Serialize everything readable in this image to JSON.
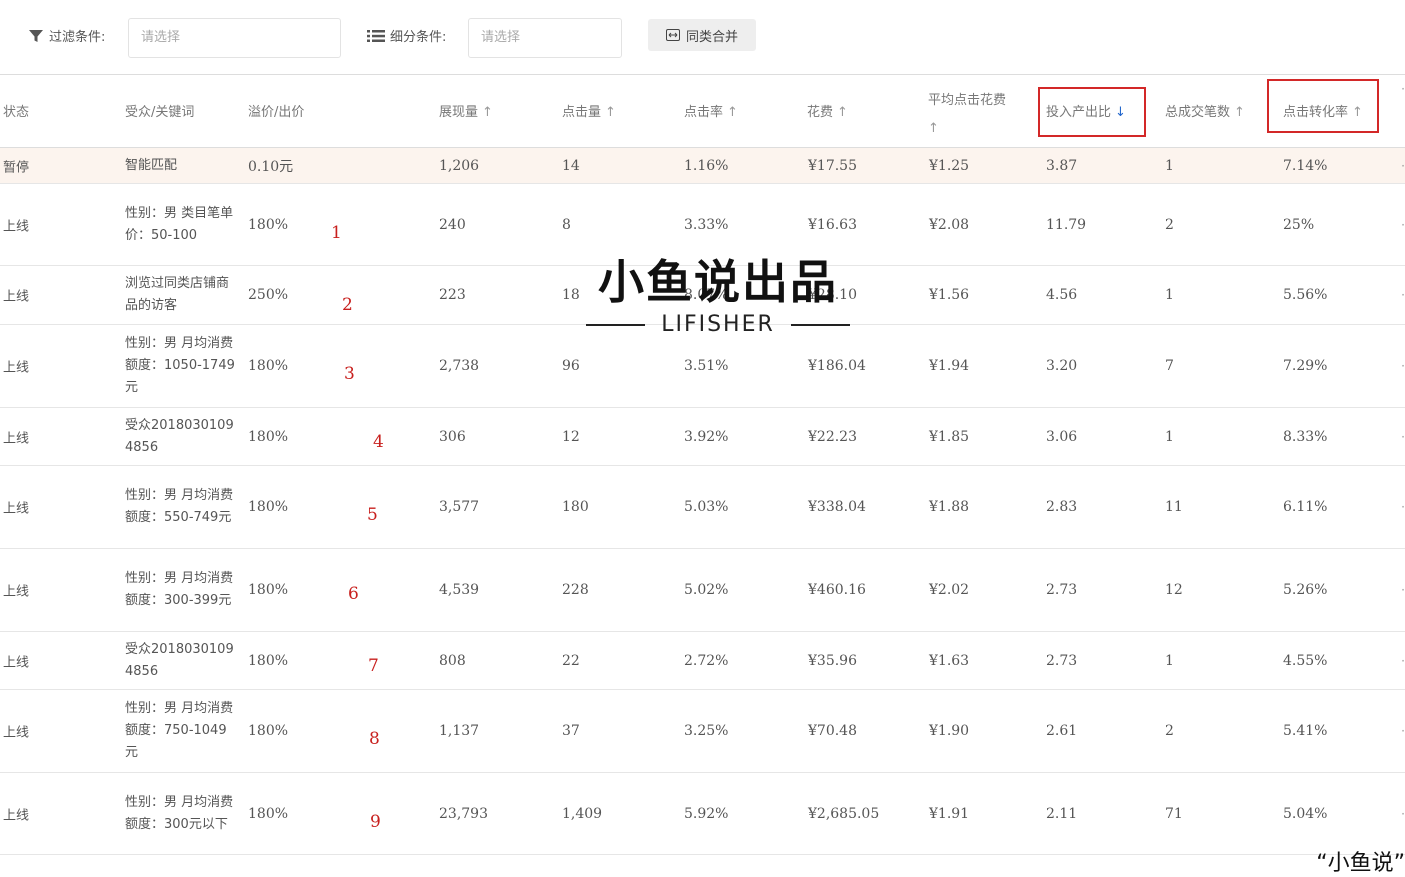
{
  "toolbar": {
    "filter_label": "过滤条件:",
    "filter_placeholder": "请选择",
    "segment_label": "细分条件:",
    "segment_placeholder": "请选择",
    "merge_button": "同类合并"
  },
  "columns": {
    "status": "状态",
    "audience": "受众/关键词",
    "bid": "溢价/出价",
    "impressions": "展现量",
    "clicks": "点击量",
    "ctr": "点击率",
    "cost": "花费",
    "avg_cpc": "平均点击花费",
    "roi": "投入产出比",
    "orders": "总成交笔数",
    "cvr": "点击转化率"
  },
  "rows": [
    {
      "status": "暂停",
      "audience": "智能匹配",
      "bid": "0.10元",
      "mark": "",
      "impressions": "1,206",
      "clicks": "14",
      "ctr": "1.16%",
      "cost": "¥17.55",
      "avg_cpc": "¥1.25",
      "roi": "3.87",
      "orders": "1",
      "cvr": "7.14%"
    },
    {
      "status": "上线",
      "audience": "性别：男 类目笔单价：50-100",
      "bid": "180%",
      "mark": "1",
      "impressions": "240",
      "clicks": "8",
      "ctr": "3.33%",
      "cost": "¥16.63",
      "avg_cpc": "¥2.08",
      "roi": "11.79",
      "orders": "2",
      "cvr": "25%"
    },
    {
      "status": "上线",
      "audience": "浏览过同类店铺商品的访客",
      "bid": "250%",
      "mark": "2",
      "impressions": "223",
      "clicks": "18",
      "ctr": "8.07%",
      "cost": "¥28.10",
      "avg_cpc": "¥1.56",
      "roi": "4.56",
      "orders": "1",
      "cvr": "5.56%"
    },
    {
      "status": "上线",
      "audience": "性别：男 月均消费额度：1050-1749元",
      "bid": "180%",
      "mark": "3",
      "impressions": "2,738",
      "clicks": "96",
      "ctr": "3.51%",
      "cost": "¥186.04",
      "avg_cpc": "¥1.94",
      "roi": "3.20",
      "orders": "7",
      "cvr": "7.29%"
    },
    {
      "status": "上线",
      "audience": "受众20180301094856",
      "bid": "180%",
      "mark": "4",
      "impressions": "306",
      "clicks": "12",
      "ctr": "3.92%",
      "cost": "¥22.23",
      "avg_cpc": "¥1.85",
      "roi": "3.06",
      "orders": "1",
      "cvr": "8.33%"
    },
    {
      "status": "上线",
      "audience": "性别：男 月均消费额度：550-749元",
      "bid": "180%",
      "mark": "5",
      "impressions": "3,577",
      "clicks": "180",
      "ctr": "5.03%",
      "cost": "¥338.04",
      "avg_cpc": "¥1.88",
      "roi": "2.83",
      "orders": "11",
      "cvr": "6.11%"
    },
    {
      "status": "上线",
      "audience": "性别：男 月均消费额度：300-399元",
      "bid": "180%",
      "mark": "6",
      "impressions": "4,539",
      "clicks": "228",
      "ctr": "5.02%",
      "cost": "¥460.16",
      "avg_cpc": "¥2.02",
      "roi": "2.73",
      "orders": "12",
      "cvr": "5.26%"
    },
    {
      "status": "上线",
      "audience": "受众20180301094856",
      "bid": "180%",
      "mark": "7",
      "impressions": "808",
      "clicks": "22",
      "ctr": "2.72%",
      "cost": "¥35.96",
      "avg_cpc": "¥1.63",
      "roi": "2.73",
      "orders": "1",
      "cvr": "4.55%"
    },
    {
      "status": "上线",
      "audience": "性别：男 月均消费额度：750-1049元",
      "bid": "180%",
      "mark": "8",
      "impressions": "1,137",
      "clicks": "37",
      "ctr": "3.25%",
      "cost": "¥70.48",
      "avg_cpc": "¥1.90",
      "roi": "2.61",
      "orders": "2",
      "cvr": "5.41%"
    },
    {
      "status": "上线",
      "audience": "性别：男 月均消费额度：300元以下",
      "bid": "180%",
      "mark": "9",
      "impressions": "23,793",
      "clicks": "1,409",
      "ctr": "5.92%",
      "cost": "¥2,685.05",
      "avg_cpc": "¥1.91",
      "roi": "2.11",
      "orders": "71",
      "cvr": "5.04%"
    }
  ],
  "watermark": {
    "main": "小鱼说出品",
    "sub": "LIFISHER",
    "corner": "“小鱼说”"
  },
  "highlight_color": "#d32828",
  "sort_active_color": "#2266cc"
}
